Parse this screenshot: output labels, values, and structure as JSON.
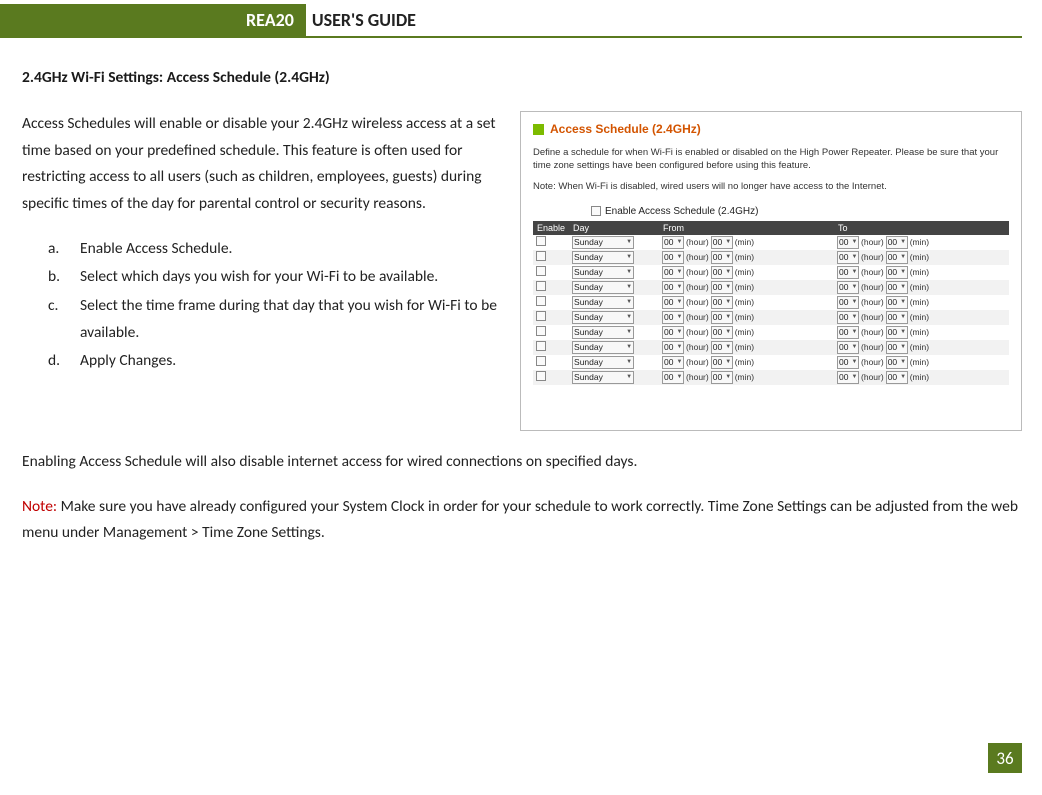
{
  "header": {
    "badge": "REA20",
    "title": "USER'S GUIDE"
  },
  "section_title": "2.4GHz Wi-Fi Settings: Access Schedule (2.4GHz)",
  "intro": "Access Schedules will enable or disable your 2.4GHz wireless access at a set time based on your predefined schedule.  This feature is often used for restricting access to all users (such as children, employees, guests) during specific times of the day for parental control or security reasons.",
  "steps": [
    {
      "letter": "a.",
      "text": "Enable Access Schedule."
    },
    {
      "letter": "b.",
      "text": "Select which days you wish for your Wi-Fi to be available."
    },
    {
      "letter": "c.",
      "text": "Select the time frame during that day that you wish for Wi-Fi to be available."
    },
    {
      "letter": "d.",
      "text": "Apply Changes."
    }
  ],
  "after_para": "Enabling Access Schedule will also disable internet access for wired connections on specified days.",
  "note_label": "Note:",
  "note_text": "  Make sure you have already configured your System Clock in order for your schedule to work correctly. Time Zone Settings can be adjusted from the web menu under Management > Time Zone Settings.",
  "page_number": "36",
  "screenshot": {
    "panel_title": "Access Schedule (2.4GHz)",
    "desc": "Define a schedule for when Wi-Fi is enabled or disabled on the High Power Repeater. Please be sure that your time zone settings have been configured before using this feature.",
    "note": "Note: When Wi-Fi is disabled, wired users will no longer have access to the Internet.",
    "enable_label": "Enable Access Schedule (2.4GHz)",
    "columns": {
      "enable": "Enable",
      "day": "Day",
      "from": "From",
      "to": "To"
    },
    "time": {
      "hour": "00",
      "min": "00",
      "hour_lbl": "(hour)",
      "min_lbl": "(min)"
    },
    "rows": [
      {
        "day": "Sunday"
      },
      {
        "day": "Sunday"
      },
      {
        "day": "Sunday"
      },
      {
        "day": "Sunday"
      },
      {
        "day": "Sunday"
      },
      {
        "day": "Sunday"
      },
      {
        "day": "Sunday"
      },
      {
        "day": "Sunday"
      },
      {
        "day": "Sunday"
      },
      {
        "day": "Sunday"
      }
    ]
  }
}
